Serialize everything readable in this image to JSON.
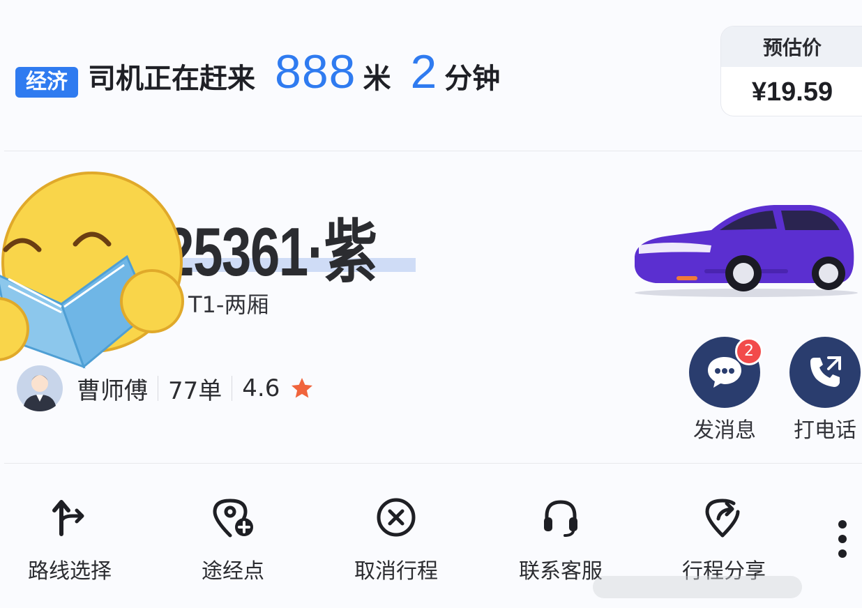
{
  "header": {
    "badge": "经济",
    "status": "司机正在赶来",
    "distance": "888",
    "distance_unit": "米",
    "eta": "2",
    "eta_unit": "分钟"
  },
  "price": {
    "label": "预估价",
    "value": "¥19.59"
  },
  "vehicle": {
    "plate": "25361·紫",
    "model": "T1-两厢",
    "color": "#5b2fd0"
  },
  "driver": {
    "name": "曹师傅",
    "orders": "77单",
    "rating": "4.6"
  },
  "contact": {
    "message_label": "发消息",
    "message_badge": "2",
    "call_label": "打电话"
  },
  "actions": [
    {
      "label": "路线选择",
      "icon": "route-icon"
    },
    {
      "label": "途经点",
      "icon": "waypoint-add-icon"
    },
    {
      "label": "取消行程",
      "icon": "cancel-icon"
    },
    {
      "label": "联系客服",
      "icon": "headset-icon"
    },
    {
      "label": "行程分享",
      "icon": "share-trip-icon"
    }
  ],
  "colors": {
    "accent": "#2f7bf0",
    "button_bg": "#2a3d6e",
    "badge_red": "#f24b4b",
    "star": "#f0643c"
  }
}
